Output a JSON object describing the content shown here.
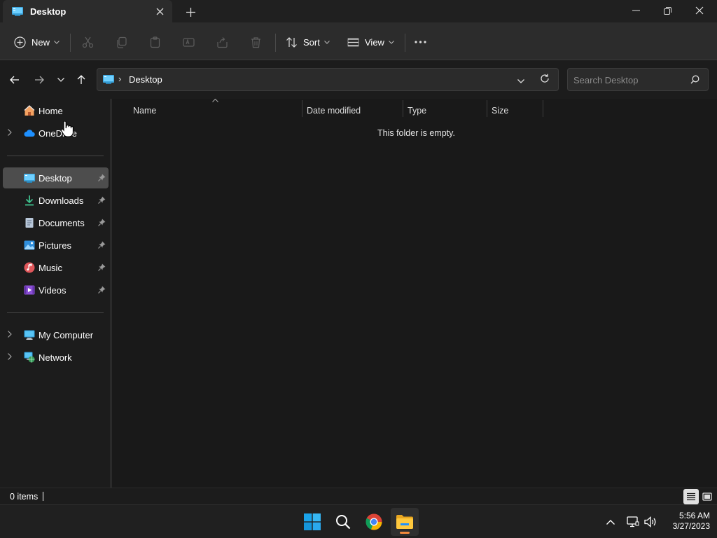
{
  "window": {
    "tab_title": "Desktop",
    "colors": {
      "accent": "#60cdff",
      "folder_yellow": "#f4c24a",
      "selected": "#4d4d4d"
    }
  },
  "commandbar": {
    "new_label": "New",
    "sort_label": "Sort",
    "view_label": "View"
  },
  "address": {
    "crumb": "Desktop",
    "search_placeholder": "Search Desktop"
  },
  "sidebar": {
    "top_items": [
      {
        "label": "Home",
        "icon": "home-icon"
      },
      {
        "label": "OneDrive",
        "icon": "cloud-icon"
      }
    ],
    "quick_access": [
      {
        "label": "Desktop",
        "icon": "desktop-icon"
      },
      {
        "label": "Downloads",
        "icon": "download-icon"
      },
      {
        "label": "Documents",
        "icon": "document-icon"
      },
      {
        "label": "Pictures",
        "icon": "pictures-icon"
      },
      {
        "label": "Music",
        "icon": "music-icon"
      },
      {
        "label": "Videos",
        "icon": "videos-icon"
      }
    ],
    "bottom_items": [
      {
        "label": "My Computer",
        "icon": "computer-icon"
      },
      {
        "label": "Network",
        "icon": "network-icon"
      }
    ]
  },
  "main": {
    "columns": [
      "Name",
      "Date modified",
      "Type",
      "Size"
    ],
    "empty_message": "This folder is empty."
  },
  "status": {
    "item_count": "0 items"
  },
  "taskbar": {
    "time": "5:56 AM",
    "date": "3/27/2023"
  }
}
